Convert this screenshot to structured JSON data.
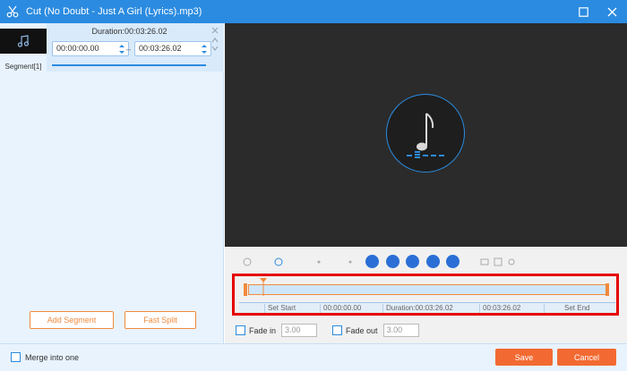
{
  "window": {
    "title": "Cut (No Doubt - Just A Girl (Lyrics).mp3)"
  },
  "segment": {
    "tab_label": "Segment[1]",
    "duration_text": "Duration:00:03:26.02",
    "start_time": "00:00:00.00",
    "end_time": "00:03:26.02",
    "separator": "–"
  },
  "left_actions": {
    "add_segment": "Add Segment",
    "fast_split": "Fast Split"
  },
  "timeline": {
    "set_start": "Set Start",
    "start_value": "00:00:00.00",
    "duration": "Duration:00:03:26.02",
    "end_value": "00:03:26.02",
    "set_end": "Set End"
  },
  "fade": {
    "fade_in_label": "Fade in",
    "fade_in_value": "3.00",
    "fade_out_label": "Fade out",
    "fade_out_value": "3.00"
  },
  "bottom": {
    "merge_label": "Merge into one",
    "save": "Save",
    "cancel": "Cancel"
  },
  "colors": {
    "titlebar": "#2b8be0",
    "accent_orange": "#f26a32",
    "highlight_red": "#e60000"
  }
}
